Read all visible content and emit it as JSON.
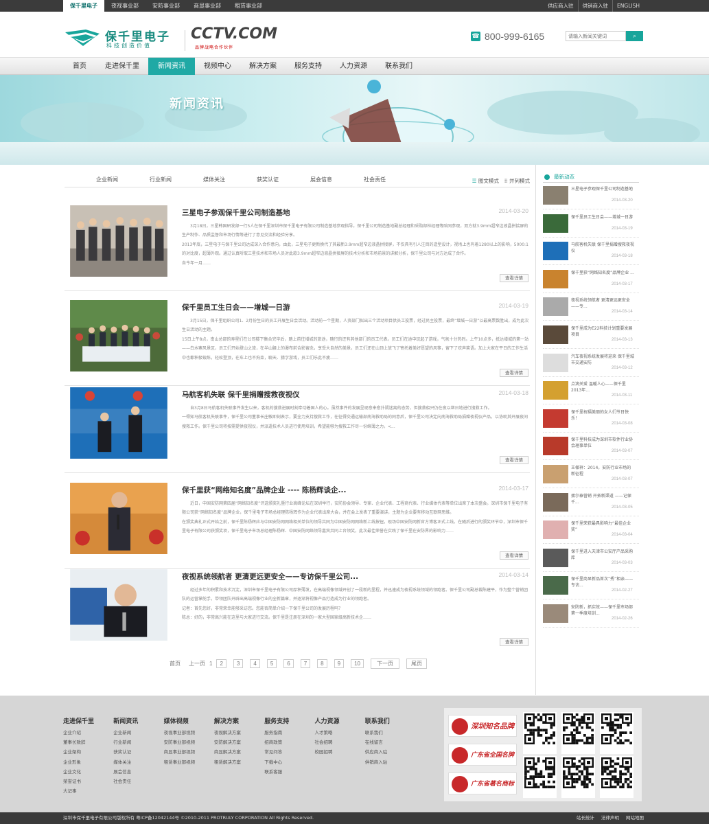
{
  "topbar": {
    "left": [
      "保千里电子",
      "夜视事业部",
      "安防事业部",
      "商显事业部",
      "租赁事业部"
    ],
    "right": [
      "供应商入驻",
      "供销商入驻",
      "ENGLISH"
    ]
  },
  "header": {
    "logo_name": "保千里电子",
    "logo_slogan": "科技创造价值",
    "logo_mark": "PROTRULY",
    "cctv": "CCTV.COM",
    "cctv_slogan": "品牌战略合作伙伴",
    "phone": "800-999-6165",
    "search_placeholder": "请输入新闻关键词",
    "search_button": "搜索"
  },
  "nav": [
    "首页",
    "走进保千里",
    "新闻资讯",
    "视频中心",
    "解决方案",
    "服务支持",
    "人力资源",
    "联系我们"
  ],
  "banner_title": "新闻资讯",
  "tabs": [
    "企业新闻",
    "行业新闻",
    "媒体关注",
    "获奖认证",
    "展会信息",
    "社会责任"
  ],
  "view_modes": [
    "图文模式",
    "并列模式"
  ],
  "news": [
    {
      "title": "三星电子参观保千里公司制造基地",
      "date": "2014-03-20",
      "body": "3月18日，三星韩国研发部一行5人在保千里深圳市保千里电子有限公司制造基地参观指导。保千里公司制造基地副总经理和采购部林经理等陪同参观，双方就3.9mm超窄边液晶拼接屏的生产制作、品质监督和市场行情等进行了意见交流和经验分享。\n2013年底，三星电子与保千里公司达成深入合作意向，由此，三星电子更新换代了其最新3.9mm超窄边液晶拼接屏，不仅具有引人注目的造型设计，视场上也有着1280以上的影响，5000:1的对比度，超薄外观。通过认真听取三星技术和市场人员对此款3.9mm超窄边液晶拼接屏的技术分析和市场前景的讲解分析，保千里公司与对方达成了合作。\n自今年一月……",
      "more": "查看详情"
    },
    {
      "title": "保千里员工生日会——增城一日游",
      "date": "2014-03-19",
      "body": "3月15日，保千里组织公司1、2月份生日的员工开展生日会活动。活动前一个星期，人资部门拟出三个活动项目供员工投票，经过民主投票，最终“增城一日游”以最高票数胜出，成为此次生日活动的主题。\n15日上午8点，南山总部的寿星们在公司楼下集合完毕后，踏上前往增城的旅途，随行的还有其他部门的员工代表。员工们在途中玩起了游戏，气氛十分热烈。上午10点多，抵达增城的第一站——白水寨风景区，员工们开始登山之旅，在半山腰上的瀑布前合影留念，享受大自然的美景。员工们还在山顶上放飞了寄托着美好愿望的风筝，留下了欢声笑语。加上大家在平日的工作生活中也都积极锻炼，轻松登顶，在车上也不拘束，聊天、猜字游戏，员工们乐此不疲……",
      "more": "查看详情"
    },
    {
      "title": "马航客机失联 保千里捐赠搜救夜视仪",
      "date": "2014-03-18",
      "body": "自3月8日马航客机失联事件发生以来，客机的搜救进展时刻牵动着国人的心。虽然事件的发展呈现愈来愈扑朔迷离的态势，但搜救船只仍在夜以继日地进行搜救工作。\n一得知马航客机失联事件，保千里公司董事长庄敏即刻表示，要全力支持搜救工作，在征得交通运输部南海救助局的同意后，保千里公司决定向南海救助局捐赠夜视仪产品，以协助其开展夜间搜救工作。保千里公司将按需提供夜视仪，并派遣技术人员进行使用培训，希望能够为搜救工作尽一份绵薄之力。<...",
      "more": "查看详情"
    },
    {
      "title": "保千里获“网络知名度”品牌企业 ---- 陈杨辉谈企...",
      "date": "2014-03-17",
      "body": "近日，中国安防网第四届“网络知名度”评选颁奖礼暨行业高峰论坛在深圳举行，安防协会领导、专家、企业代表、工程商代表、行业媒体代表等单位出席了本次盛会。深圳市保千里电子有限公司获“网络知名度”品牌企业，保千里电子市场总经理陈杨辉作为企业代表出席大会，并在会上发表了重要演讲，主题为企业要有移动互联网思维。\n在颁奖典礼正式开始之前，保千里陈杨辉应与中国安防网网络相关单位的领导共同为中国安防网网络新上线按钮，现场中国安防网新官方博客正式上线。在随后进行的颁奖环节中，深圳市保千里电子有限公司获颁奖项，保千里电子市场总经理陈杨辉、中国安防网络领导嘉宾共同上台领奖，此次最佳荣誉在实践了保千里在安防界的影响力……",
      "more": "查看详情"
    },
    {
      "title": "夜视系统领航者 更清更远更安全——专访保千里公司...",
      "date": "2014-03-14",
      "body": "经过多年的积累和技术沉淀，深圳市保千里电子有限公司厚积薄发，在高端视像领域开创了一段新的里程，并迅速成为夜视系统领域的领跑者。保千里公司副总裁陈建平，作为整个营销团队的运营掌舵手，带领团队开辟出高端视像行业的全新篇章，并逐渐将视像产品打造成为行业的领跑者。\n记者：首先您好，非常荣幸能够采访您。您能否简单介绍一下保千里公司的发展历程吗？\n陈总：好的，非常高兴能在这里与大家进行交流。保千里是注册在深圳的一家大型国家级高新技术企……",
      "more": "查看详情"
    }
  ],
  "pager": {
    "first": "首页",
    "prev": "上一页",
    "current": "1",
    "pages": [
      "2",
      "3",
      "4",
      "5",
      "6",
      "7",
      "8",
      "9",
      "10"
    ],
    "next": "下一页",
    "last": "尾页"
  },
  "sidebar": {
    "title": "最新动态",
    "items": [
      {
        "text": "三星电子参观保千里公司制造基地",
        "date": "2014-03-20"
      },
      {
        "text": "保千里员工生日会——增城一日游",
        "date": "2014-03-19"
      },
      {
        "text": "马航客机失联 保千里捐赠搜救夜视仪",
        "date": "2014-03-18"
      },
      {
        "text": "保千里获“网络知名度”品牌企业 ...",
        "date": "2014-03-17"
      },
      {
        "text": "夜视系统领航者 更清更远更安全——专...",
        "date": "2014-03-14"
      },
      {
        "text": "保千里成为E22科技计划重要发展项目",
        "date": "2014-03-13"
      },
      {
        "text": "汽车夜视系统发展将迎来 保千里城市交通安防",
        "date": "2014-03-12"
      },
      {
        "text": "点滴关爱 温暖人心——保千里2013年...",
        "date": "2014-03-11"
      },
      {
        "text": "保千里祝福美丽的女人们节日快乐！",
        "date": "2014-03-08"
      },
      {
        "text": "保千里科技成为深圳市软件行业协会理事单位",
        "date": "2014-03-07"
      },
      {
        "text": "王樑祥：2014，安防行业市场的新征程",
        "date": "2014-03-07"
      },
      {
        "text": "蛋尔泰营销 开拓新渠道 ——记保千...",
        "date": "2014-03-05"
      },
      {
        "text": "保千里荣获最具影响力“最佳企业奖”",
        "date": "2014-03-04"
      },
      {
        "text": "保千里进入天津市公安厅产品采购库",
        "date": "2014-03-03"
      },
      {
        "text": "保千里商显新品首次“秀”相亲——专访...",
        "date": "2014-02-27"
      },
      {
        "text": "安防新，抓实效——保千里市场部第一季度培训...",
        "date": "2014-02-26"
      }
    ]
  },
  "footer": {
    "columns": [
      {
        "head": "走进保千里",
        "links": [
          "企业介绍",
          "董事长致辞",
          "企业架构",
          "企业形象",
          "企业文化",
          "荣誉证书",
          "大记事"
        ]
      },
      {
        "head": "新闻资讯",
        "links": [
          "企业新闻",
          "行业新闻",
          "获奖认证",
          "媒体关注",
          "展会信息",
          "社会责任"
        ]
      },
      {
        "head": "媒体视频",
        "links": [
          "夜视事业部视频",
          "安防事业部视频",
          "商显事业部视频",
          "租赁事业部视频"
        ]
      },
      {
        "head": "解决方案",
        "links": [
          "夜视解决方案",
          "安防解决方案",
          "商显解决方案",
          "租赁解决方案"
        ]
      },
      {
        "head": "服务支持",
        "links": [
          "服务指南",
          "招商政策",
          "常见问答",
          "下载中心",
          "联系客服"
        ]
      },
      {
        "head": "人力资源",
        "links": [
          "人才策略",
          "社会招聘",
          "校园招聘"
        ]
      },
      {
        "head": "联系我们",
        "links": [
          "联系我们",
          "在线留言",
          "供应商入驻",
          "供销商入驻"
        ]
      }
    ],
    "badges": [
      "深圳知名品牌",
      "广东省全国名牌",
      "广东省著名商标"
    ]
  },
  "copyright": {
    "text": "深圳市保千里电子有限公司版权所有 粤ICP备12042144号 ©2010-2011 PROTRULY CORPORATION All Rights Reserved.",
    "links": [
      "站长统计",
      "法律声明",
      "网站地图"
    ]
  },
  "colors": {
    "brand": "#17a59b",
    "nav_active": "#20a9a5",
    "badge_red": "#c8282a"
  }
}
